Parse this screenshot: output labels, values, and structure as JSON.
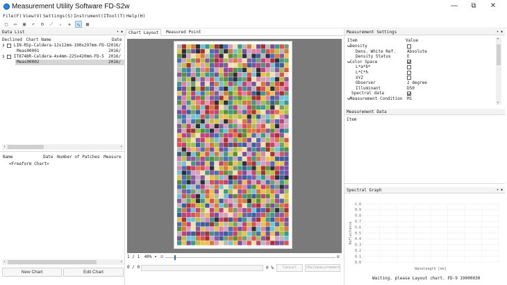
{
  "window": {
    "title": "Measurement Utility Software FD-S2w",
    "minimize": "—",
    "restore": "⧉",
    "close": "✕"
  },
  "menu": [
    "File(F)",
    "View(V)",
    "Settings(S)",
    "Instrument(I)",
    "Tool(T)",
    "Help(H)"
  ],
  "toolbar": [
    "new-icon",
    "open-icon",
    "save-icon",
    "undo-icon",
    "gear-icon",
    "measure-icon",
    "patch-icon",
    "chart-icon",
    "graph-icon",
    "grid-icon"
  ],
  "data_list": {
    "title": "Data List",
    "columns": [
      "Declined",
      "Chart Name",
      "Date"
    ],
    "items": [
      {
        "name": "LIN-R5p-Caldera-12x12mm-190x297mm-FD-9",
        "date": "2016/",
        "child": "Meas00001",
        "child_date": "2016/"
      },
      {
        "name": "IT8748R-Caldera-4x4mm-225x420mm-FD-5",
        "date": "2016/",
        "child": "Meas00002",
        "child_date": "2016/"
      }
    ]
  },
  "patch_list": {
    "columns": [
      "Name",
      "Date",
      "Number of Patches",
      "Measure"
    ],
    "row": "<Freeform Chart>"
  },
  "buttons": {
    "new_chart": "New Chart",
    "edit_chart": "Edit Chart"
  },
  "tabs": {
    "chart_layout": "Chart Layout",
    "measured_point": "Measured Point"
  },
  "zoom": {
    "page": "1 / 1",
    "percent": "40%"
  },
  "progress": {
    "count": "0 / 0",
    "percent": "0 %",
    "cancel": "Cancel",
    "remeasure": "(Re)measurement"
  },
  "settings": {
    "title": "Measurement Settings",
    "col_item": "Item",
    "col_value": "Value",
    "rows": [
      {
        "label": "Density",
        "value": "",
        "indent": 0,
        "expander": "❯",
        "check": "off"
      },
      {
        "label": "Dens. White Ref.",
        "value": "Absolute",
        "indent": 2
      },
      {
        "label": "Density Status",
        "value": "E",
        "indent": 2
      },
      {
        "label": "Color Space",
        "value": "",
        "indent": 0,
        "expander": "❯",
        "check": "on"
      },
      {
        "label": "L*a*b*",
        "value": "",
        "indent": 2,
        "check": "off"
      },
      {
        "label": "L*C*h",
        "value": "",
        "indent": 2,
        "check": "off"
      },
      {
        "label": "XYZ",
        "value": "",
        "indent": 2,
        "check": "off"
      },
      {
        "label": "Observer",
        "value": "2 degree",
        "indent": 2
      },
      {
        "label": "Illuminant",
        "value": "D50",
        "indent": 2
      },
      {
        "label": "Spectral data",
        "value": "",
        "indent": 1,
        "check": "on"
      },
      {
        "label": "Measurement Condition",
        "value": "M1",
        "indent": 0,
        "expander": "❯"
      }
    ]
  },
  "measurement_data": {
    "title": "Measurement Data",
    "col": "Item"
  },
  "spectral_graph": {
    "title": "Spectral Graph",
    "yticks": [
      "1.0",
      "0.9",
      "0.8",
      "0.7",
      "0.6",
      "0.5",
      "0.4",
      "0.3",
      "0.2",
      "0.1",
      "0.0"
    ],
    "ylabel": "Reflectance",
    "xlabel": "Wavelength [nm]"
  },
  "status": "Waiting. please Layout chart. FD-9 19000030"
}
